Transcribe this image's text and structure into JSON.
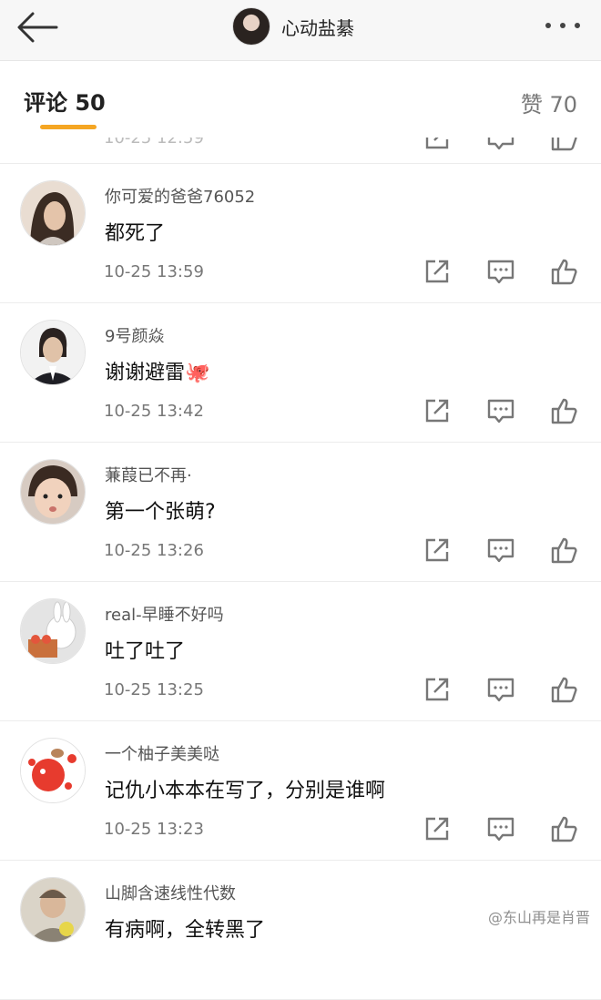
{
  "nav": {
    "title": "心动盐綦",
    "back_icon": "arrow-left-icon",
    "more_icon": "more-dots-icon"
  },
  "tabs": {
    "comments_label": "评论 50",
    "likes_label": "赞 70",
    "accent": "#f5a623"
  },
  "partial_comment": {
    "time": "10-25 12:59"
  },
  "comments": [
    {
      "user": "你可爱的爸爸76052",
      "text": "都死了",
      "time": "10-25 13:59"
    },
    {
      "user": "9号颜焱",
      "text": "谢谢避雷",
      "emoji": "🐙",
      "time": "10-25 13:42"
    },
    {
      "user": "蒹葭已不再·",
      "text": "第一个张萌?",
      "time": "10-25 13:26"
    },
    {
      "user": "real-早睡不好吗",
      "text": "吐了吐了",
      "time": "10-25 13:25"
    },
    {
      "user": "一个柚子美美哒",
      "text": "记仇小本本在写了，分别是谁啊",
      "time": "10-25 13:23"
    },
    {
      "user": "山脚含速线性代数",
      "text": "有病啊，全转黑了",
      "time": ""
    }
  ],
  "watermark": "@东山再是肖晋"
}
